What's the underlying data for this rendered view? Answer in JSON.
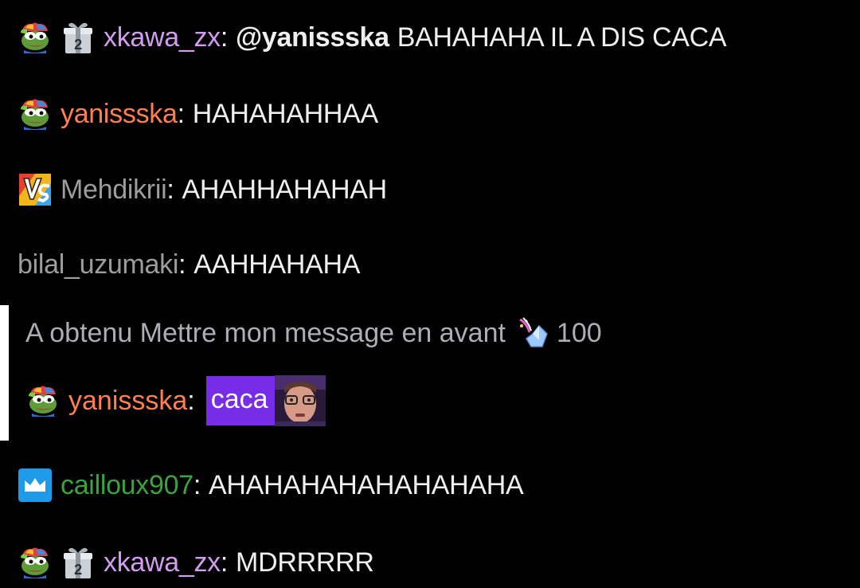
{
  "colors": {
    "background": "#000000",
    "text": "#efeff1",
    "xkawa": "#d49cf0",
    "yanis": "#ff7f50",
    "mehdi": "#9d9d9d",
    "bilal": "#9d9d9d",
    "caillou": "#3aa33a",
    "highlight_pill": "#772ce8",
    "highlight_bar": "#ffffff"
  },
  "messages": [
    {
      "badges": [
        "pepe-rainbow-icon",
        "gift-2-icon"
      ],
      "user": "xkawa_zx",
      "mention": "@yanissska",
      "text": "BAHAHAHA IL A DIS CACA"
    },
    {
      "badges": [
        "pepe-rainbow-icon"
      ],
      "user": "yanissska",
      "text": "HAHAHAHHAA"
    },
    {
      "badges": [
        "vs-badge-icon"
      ],
      "user": "Mehdikrii",
      "text": "AHAHHAHAHAH"
    },
    {
      "badges": [],
      "user": "bilal_uzumaki",
      "text": "AAHHAHAHA"
    },
    {
      "badges": [
        "crown-icon"
      ],
      "user": "cailloux907",
      "text": "AHAHAHAHAHAHAHAHA"
    },
    {
      "badges": [
        "pepe-rainbow-icon",
        "gift-2-icon"
      ],
      "user": "xkawa_zx",
      "text": "MDRRRRR"
    }
  ],
  "highlight": {
    "note": "A obtenu Mettre mon message en avant",
    "cost": "100",
    "badges": [
      "pepe-rainbow-icon"
    ],
    "user": "yanissska",
    "text": "caca",
    "emote": "face-emote"
  },
  "separator": ":"
}
